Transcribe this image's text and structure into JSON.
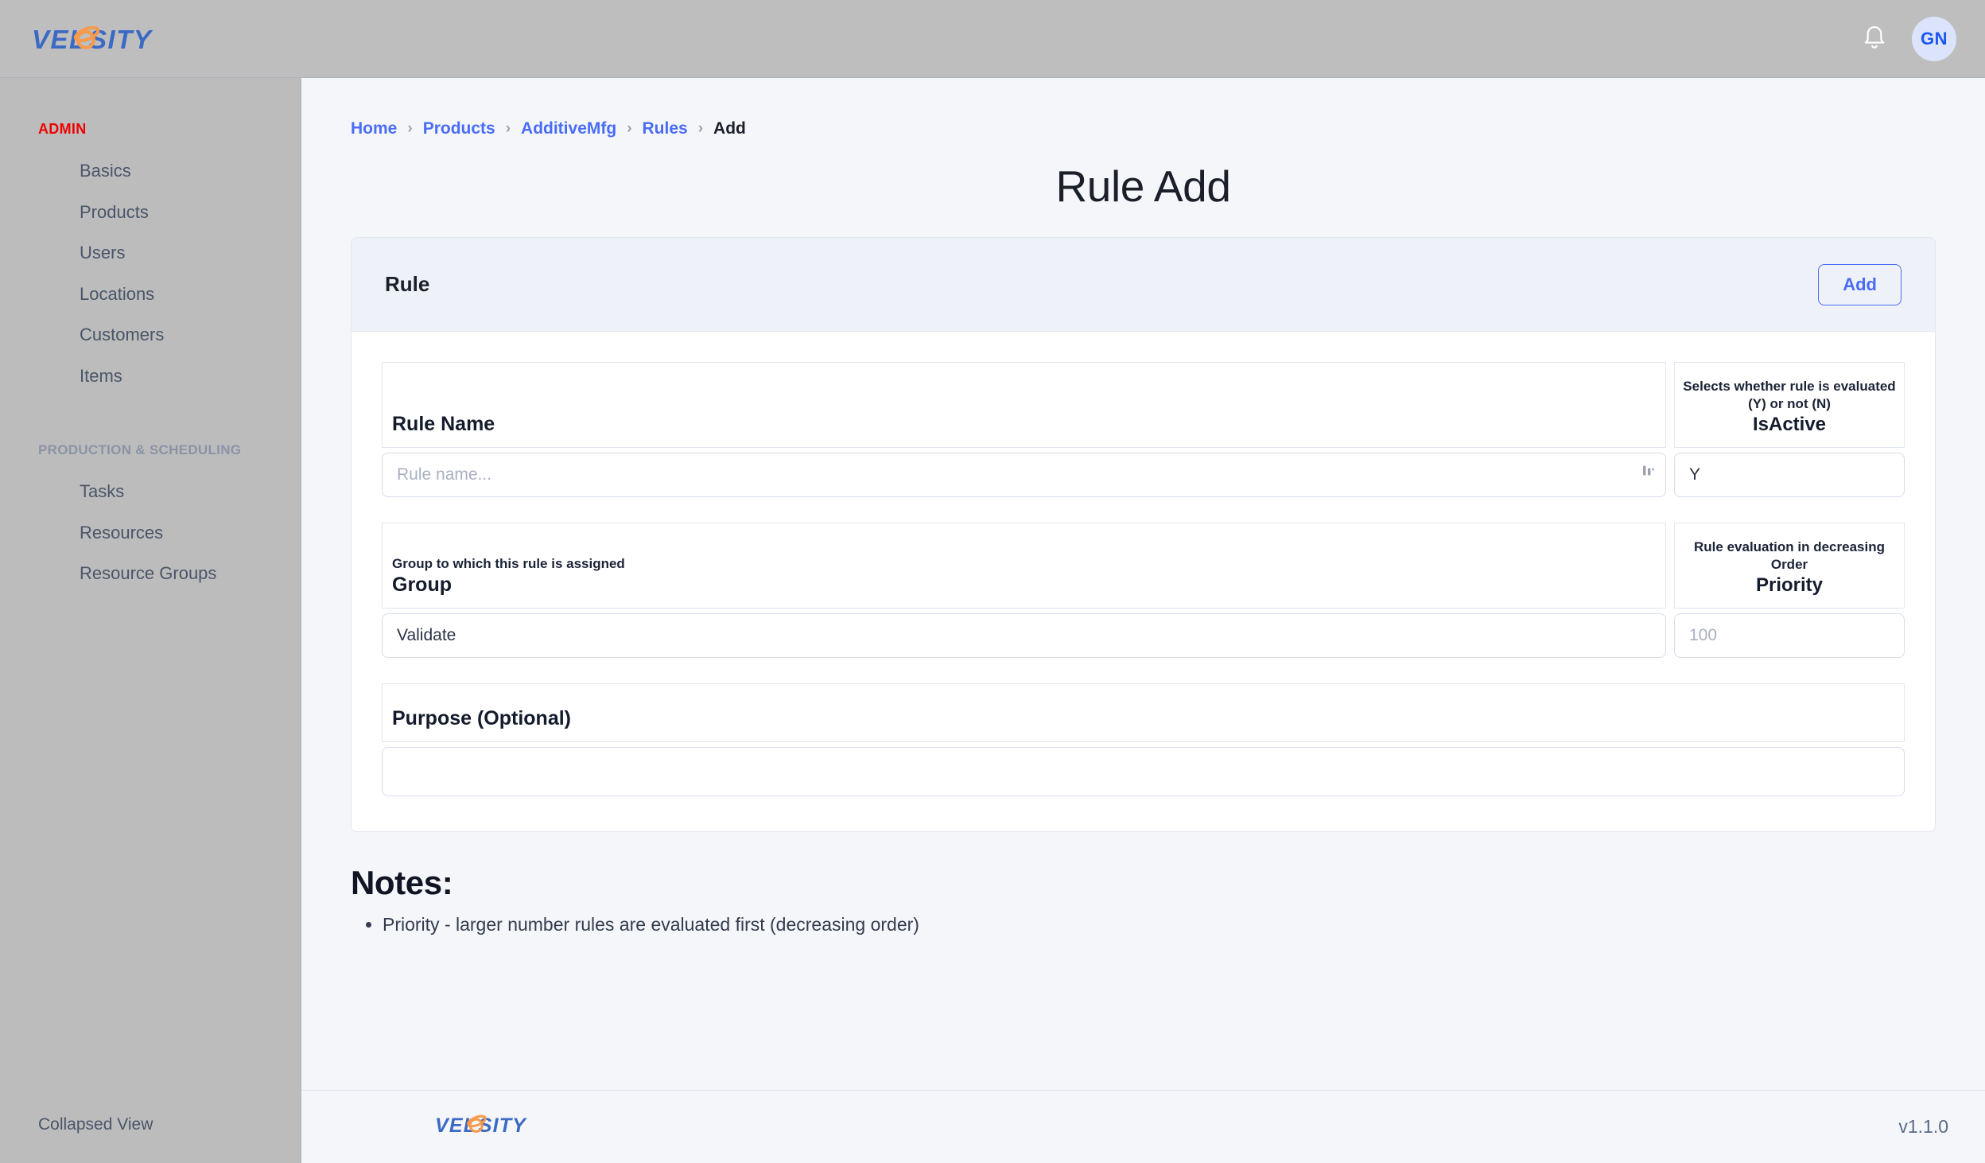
{
  "header": {
    "logo_text": "VELOSITY",
    "bell_icon": "bell-icon",
    "avatar_initials": "GN"
  },
  "sidebar": {
    "sections": [
      {
        "title": "ADMIN",
        "items": [
          {
            "label": "Basics"
          },
          {
            "label": "Products"
          },
          {
            "label": "Users"
          },
          {
            "label": "Locations"
          },
          {
            "label": "Customers"
          },
          {
            "label": "Items"
          }
        ]
      },
      {
        "title": "PRODUCTION & SCHEDULING",
        "items": [
          {
            "label": "Tasks"
          },
          {
            "label": "Resources"
          },
          {
            "label": "Resource Groups"
          }
        ]
      }
    ],
    "footer_label": "Collapsed View"
  },
  "breadcrumb": {
    "items": [
      {
        "label": "Home",
        "current": false
      },
      {
        "label": "Products",
        "current": false
      },
      {
        "label": "AdditiveMfg",
        "current": false
      },
      {
        "label": "Rules",
        "current": false
      },
      {
        "label": "Add",
        "current": true
      }
    ],
    "separator": "›"
  },
  "page": {
    "title": "Rule Add"
  },
  "card": {
    "title": "Rule",
    "add_button_label": "Add"
  },
  "form": {
    "rule_name": {
      "label": "Rule Name",
      "hint": "",
      "placeholder": "Rule name...",
      "value": "",
      "grip_icon": "resize-grip-icon"
    },
    "is_active": {
      "label": "IsActive",
      "hint": "Selects whether rule is evaluated (Y) or not (N)",
      "placeholder": "",
      "value": "Y"
    },
    "group": {
      "label": "Group",
      "hint": "Group to which this rule is assigned",
      "placeholder": "",
      "value": "Validate"
    },
    "priority": {
      "label": "Priority",
      "hint": "Rule evaluation in decreasing Order",
      "placeholder": "100",
      "value": ""
    },
    "purpose": {
      "label": "Purpose (Optional)",
      "hint": "",
      "placeholder": "",
      "value": ""
    }
  },
  "notes": {
    "title": "Notes:",
    "items": [
      "Priority - larger number rules are evaluated first (decreasing order)"
    ]
  },
  "footer": {
    "logo_text": "VELOSITY",
    "version": "v1.1.0"
  },
  "colors": {
    "accent_blue": "#4a6cf7",
    "logo_blue": "#3b6ac4",
    "logo_orange": "#f79a4b",
    "admin_red": "#ef0000",
    "topbar_gray": "#bebebe",
    "sidebar_gray": "#bcbcbc",
    "page_bg": "#f4f6fa"
  }
}
